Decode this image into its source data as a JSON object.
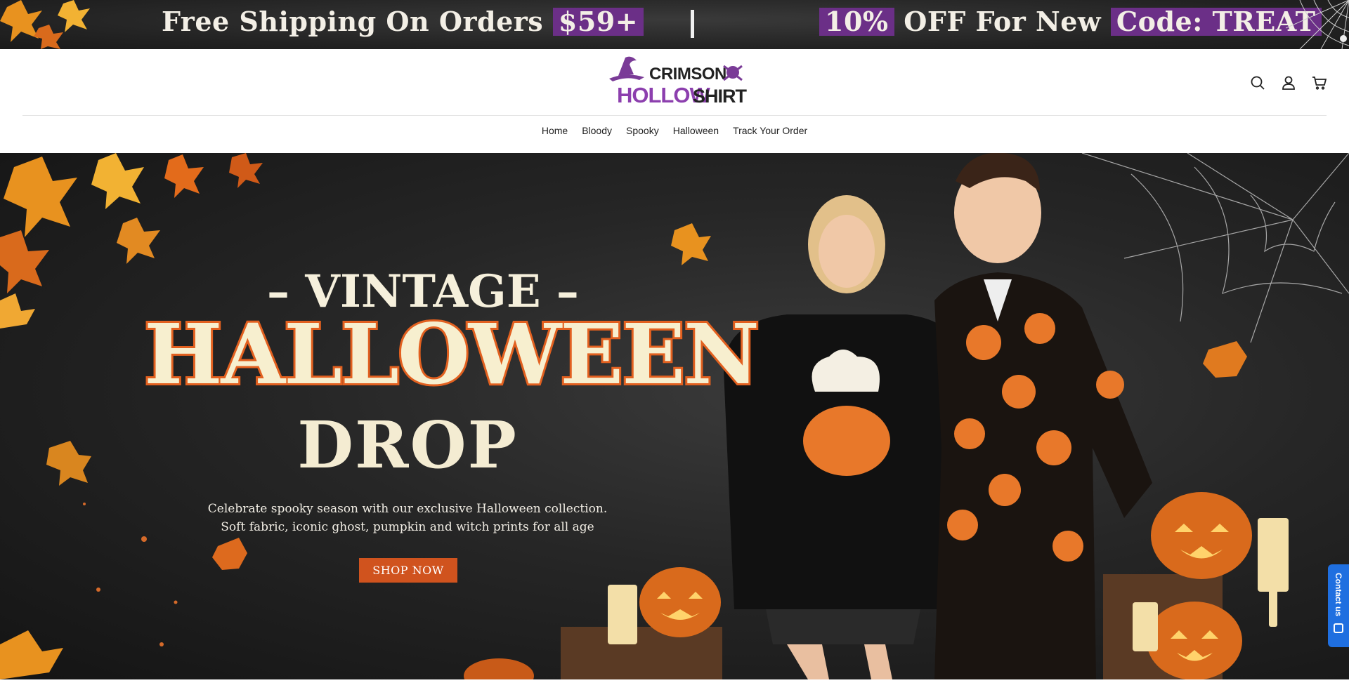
{
  "announcement": {
    "left_text": "Free Shipping On Orders",
    "left_badge": "$59+",
    "right_badge1": "10%",
    "right_text": "OFF For New",
    "right_badge2": "Code: TREAT"
  },
  "logo": {
    "line1": "CRIMSON",
    "line2": "HOLLOW",
    "line3": "SHIRT"
  },
  "header_icons": [
    "search-icon",
    "account-icon",
    "cart-icon"
  ],
  "nav": {
    "items": [
      "Home",
      "Bloody",
      "Spooky",
      "Halloween",
      "Track Your Order"
    ]
  },
  "hero": {
    "title_top": "– VINTAGE –",
    "title_main": "HALLOWEEN",
    "title_sub": "DROP",
    "desc_line1": "Celebrate spooky season with our exclusive Halloween collection.",
    "desc_line2": "Soft fabric, iconic ghost, pumpkin and witch prints for all age",
    "cta": "SHOP NOW"
  },
  "contact_tab": {
    "label": "Contact us"
  },
  "colors": {
    "accent_purple": "#6b2f87",
    "cta_orange": "#d0531e",
    "contact_blue": "#1f6fe0"
  }
}
